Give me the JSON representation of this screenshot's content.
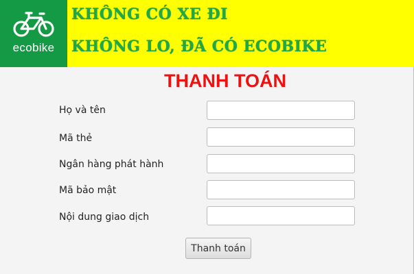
{
  "brand": {
    "logo_text": "ecobike",
    "slogan_line1": "KHÔNG CÓ XE ĐI",
    "slogan_line2": "KHÔNG LO, ĐÃ CÓ ECOBIKE"
  },
  "form": {
    "title": "THANH TOÁN",
    "fields": [
      {
        "label": "Họ và tên",
        "value": ""
      },
      {
        "label": "Mã thẻ",
        "value": ""
      },
      {
        "label": "Ngân hàng phát hành",
        "value": ""
      },
      {
        "label": "Mã bảo mật",
        "value": ""
      },
      {
        "label": "Nội dung giao dịch",
        "value": ""
      }
    ],
    "submit_label": "Thanh toán"
  },
  "colors": {
    "header_bg": "#ffff00",
    "logo_bg": "#149a44",
    "slogan": "#1ea84a",
    "title": "#ef1010"
  }
}
